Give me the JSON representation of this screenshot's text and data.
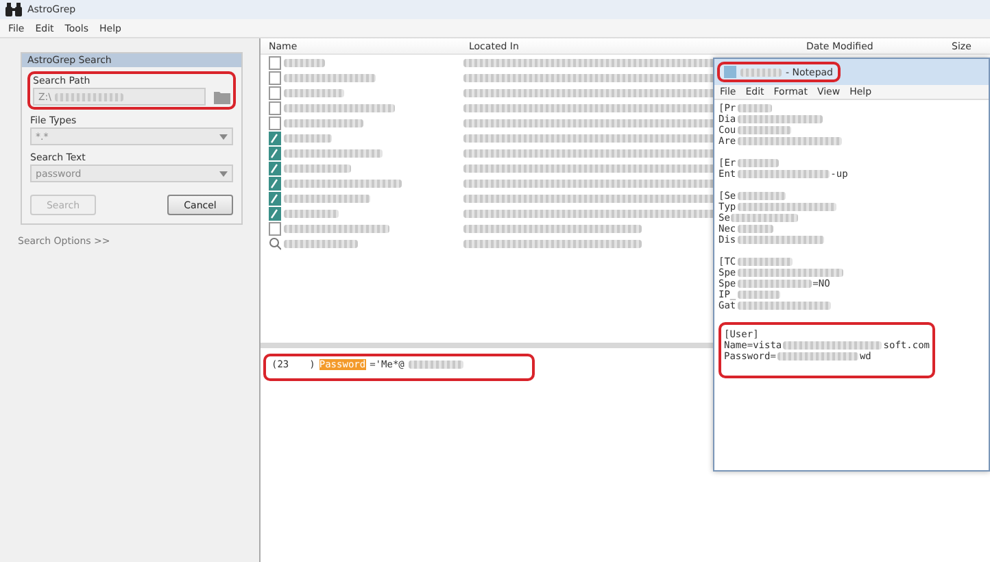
{
  "window": {
    "title": "AstroGrep"
  },
  "menu": [
    "File",
    "Edit",
    "Tools",
    "Help"
  ],
  "search_panel": {
    "title": "AstroGrep Search",
    "fields": [
      {
        "label": "Search Path",
        "kind": "path",
        "value": "Z:\\",
        "annotated": true
      },
      {
        "label": "File Types",
        "kind": "combo",
        "value": "*.*",
        "annotated": false
      },
      {
        "label": "Search Text",
        "kind": "combo",
        "value": "password",
        "annotated": false
      }
    ],
    "buttons": [
      {
        "label": "Search",
        "disabled": true
      },
      {
        "label": "Cancel",
        "disabled": false
      }
    ],
    "options_link": "Search Options >>"
  },
  "results": {
    "columns": [
      "Name",
      "Located In",
      "Date Modified",
      "Size"
    ],
    "rows": [
      {
        "kind": "file"
      },
      {
        "kind": "file"
      },
      {
        "kind": "file"
      },
      {
        "kind": "file"
      },
      {
        "kind": "file"
      },
      {
        "kind": "notepad"
      },
      {
        "kind": "notepad"
      },
      {
        "kind": "notepad"
      },
      {
        "kind": "notepad"
      },
      {
        "kind": "notepad"
      },
      {
        "kind": "notepad"
      },
      {
        "kind": "file"
      },
      {
        "kind": "search"
      }
    ]
  },
  "preview": {
    "line_number": "(23",
    "bracket": ")",
    "match": "Password",
    "rest": "='Me*@",
    "annotated": true
  },
  "notepad": {
    "title": "- Notepad",
    "menu": [
      "File",
      "Edit",
      "Format",
      "View",
      "Help"
    ],
    "sections": [
      {
        "annotated": false,
        "lines": [
          {
            "text": "[Pr",
            "redacted": true
          },
          {
            "text": "Dia",
            "redacted": true
          },
          {
            "text": "Cou",
            "redacted": true
          },
          {
            "text": "Are",
            "redacted": true
          }
        ]
      },
      {
        "annotated": false,
        "lines": [
          {
            "text": "[Er",
            "redacted": true
          },
          {
            "text": "Ent",
            "tail": "-up",
            "redacted": true
          }
        ]
      },
      {
        "annotated": false,
        "lines": [
          {
            "text": "[Se",
            "redacted": true
          },
          {
            "text": "Typ",
            "redacted": true
          },
          {
            "text": "Se",
            "redacted": true
          },
          {
            "text": "Nec",
            "redacted": true
          },
          {
            "text": "Dis",
            "redacted": true
          }
        ]
      },
      {
        "annotated": false,
        "lines": [
          {
            "text": "[TC",
            "redacted": true
          },
          {
            "text": "Spe",
            "redacted": true
          },
          {
            "text": "Spe",
            "tail": "=NO",
            "redacted": true
          },
          {
            "text": "IP_",
            "redacted": true
          },
          {
            "text": "Gat",
            "redacted": true
          }
        ]
      },
      {
        "annotated": true,
        "lines": [
          {
            "text": "[User]",
            "redacted": false
          },
          {
            "text": "Name=vista",
            "tail": "soft.com",
            "redacted": true
          },
          {
            "text": "Password=",
            "tail": "wd",
            "redacted": true
          }
        ]
      }
    ]
  }
}
